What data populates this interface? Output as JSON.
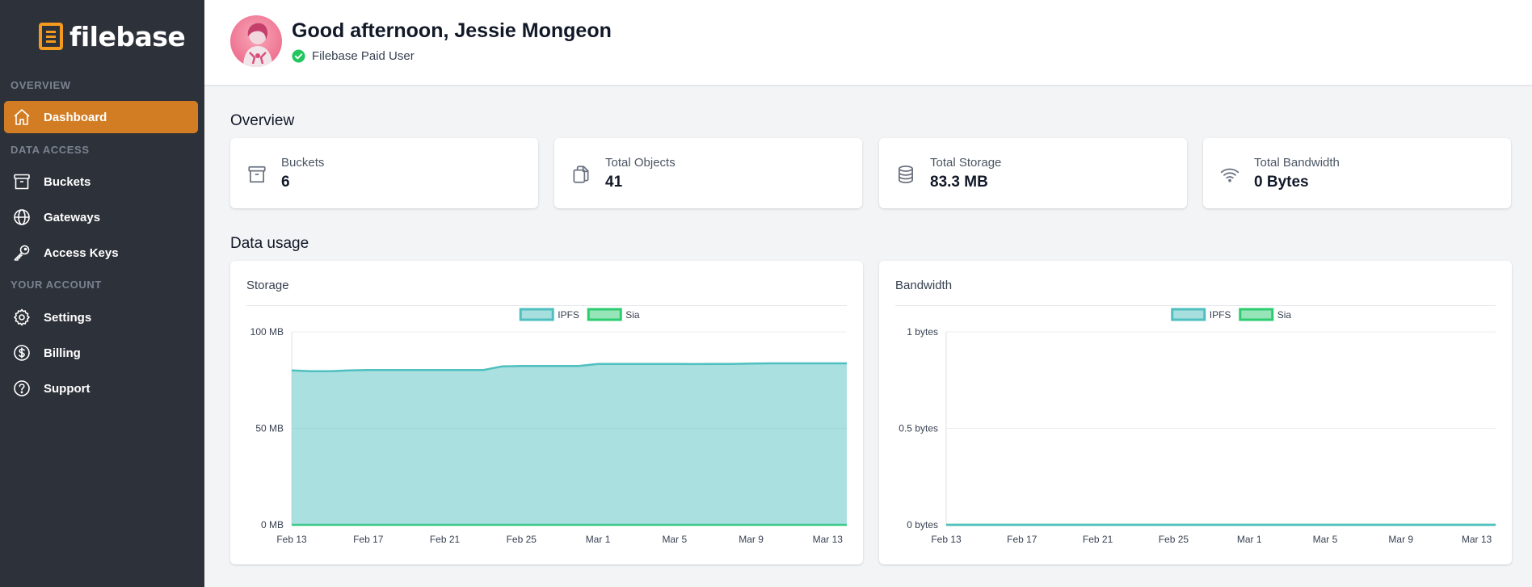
{
  "brand": {
    "name": "filebase",
    "accent": "#d27d23"
  },
  "sidebar": {
    "sections": [
      {
        "label": "OVERVIEW"
      },
      {
        "label": "DATA ACCESS"
      },
      {
        "label": "YOUR ACCOUNT"
      }
    ],
    "items": [
      {
        "label": "Dashboard",
        "icon": "home-icon",
        "active": true
      },
      {
        "label": "Buckets",
        "icon": "archive-icon"
      },
      {
        "label": "Gateways",
        "icon": "globe-icon"
      },
      {
        "label": "Access Keys",
        "icon": "key-icon"
      },
      {
        "label": "Settings",
        "icon": "gear-icon"
      },
      {
        "label": "Billing",
        "icon": "dollar-circle-icon"
      },
      {
        "label": "Support",
        "icon": "question-circle-icon"
      }
    ]
  },
  "header": {
    "greeting": "Good afternoon, Jessie Mongeon",
    "status": "Filebase Paid User"
  },
  "overview": {
    "title": "Overview",
    "stats": [
      {
        "label": "Buckets",
        "value": "6",
        "icon": "archive-icon"
      },
      {
        "label": "Total Objects",
        "value": "41",
        "icon": "copy-icon"
      },
      {
        "label": "Total Storage",
        "value": "83.3 MB",
        "icon": "database-icon"
      },
      {
        "label": "Total Bandwidth",
        "value": "0 Bytes",
        "icon": "wifi-icon"
      }
    ]
  },
  "data_usage": {
    "title": "Data usage"
  },
  "chart_data": [
    {
      "type": "area",
      "title": "Storage",
      "legend": [
        "IPFS",
        "Sia"
      ],
      "legend_position": "top-center",
      "grid": true,
      "colors": {
        "IPFS": "#4fbfbf",
        "Sia": "#2ecc71"
      },
      "y_ticks": [
        "100 MB",
        "50 MB",
        "0 MB"
      ],
      "ylim": [
        0,
        100
      ],
      "x_ticks": [
        "Feb 13",
        "Feb 17",
        "Feb 21",
        "Feb 25",
        "Mar 1",
        "Mar 5",
        "Mar 9",
        "Mar 13"
      ],
      "x": [
        "Feb 13",
        "Feb 14",
        "Feb 15",
        "Feb 16",
        "Feb 17",
        "Feb 18",
        "Feb 19",
        "Feb 20",
        "Feb 21",
        "Feb 22",
        "Feb 23",
        "Feb 24",
        "Feb 25",
        "Feb 26",
        "Feb 27",
        "Feb 28",
        "Mar 1",
        "Mar 2",
        "Mar 3",
        "Mar 4",
        "Mar 5",
        "Mar 6",
        "Mar 7",
        "Mar 8",
        "Mar 9",
        "Mar 10",
        "Mar 11",
        "Mar 12",
        "Mar 13",
        "Mar 14"
      ],
      "series": [
        {
          "name": "IPFS",
          "values": [
            80.0,
            79.6,
            79.6,
            80.0,
            80.2,
            80.2,
            80.2,
            80.2,
            80.2,
            80.2,
            80.2,
            82.1,
            82.3,
            82.3,
            82.3,
            82.3,
            83.4,
            83.4,
            83.4,
            83.4,
            83.4,
            83.3,
            83.4,
            83.4,
            83.6,
            83.7,
            83.7,
            83.7,
            83.7,
            83.7
          ]
        },
        {
          "name": "Sia",
          "values": [
            0,
            0,
            0,
            0,
            0,
            0,
            0,
            0,
            0,
            0,
            0,
            0,
            0,
            0,
            0,
            0,
            0,
            0,
            0,
            0,
            0,
            0,
            0,
            0,
            0,
            0,
            0,
            0,
            0,
            0
          ]
        }
      ]
    },
    {
      "type": "area",
      "title": "Bandwidth",
      "legend": [
        "IPFS",
        "Sia"
      ],
      "legend_position": "top-center",
      "grid": true,
      "colors": {
        "IPFS": "#4fbfbf",
        "Sia": "#2ecc71"
      },
      "y_ticks": [
        "1 bytes",
        "0.5 bytes",
        "0 bytes"
      ],
      "ylim": [
        0,
        1
      ],
      "x_ticks": [
        "Feb 13",
        "Feb 17",
        "Feb 21",
        "Feb 25",
        "Mar 1",
        "Mar 5",
        "Mar 9",
        "Mar 13"
      ],
      "x": [
        "Feb 13",
        "Feb 14",
        "Feb 15",
        "Feb 16",
        "Feb 17",
        "Feb 18",
        "Feb 19",
        "Feb 20",
        "Feb 21",
        "Feb 22",
        "Feb 23",
        "Feb 24",
        "Feb 25",
        "Feb 26",
        "Feb 27",
        "Feb 28",
        "Mar 1",
        "Mar 2",
        "Mar 3",
        "Mar 4",
        "Mar 5",
        "Mar 6",
        "Mar 7",
        "Mar 8",
        "Mar 9",
        "Mar 10",
        "Mar 11",
        "Mar 12",
        "Mar 13",
        "Mar 14"
      ],
      "series": [
        {
          "name": "IPFS",
          "values": [
            0,
            0,
            0,
            0,
            0,
            0,
            0,
            0,
            0,
            0,
            0,
            0,
            0,
            0,
            0,
            0,
            0,
            0,
            0,
            0,
            0,
            0,
            0,
            0,
            0,
            0,
            0,
            0,
            0,
            0
          ]
        },
        {
          "name": "Sia",
          "values": [
            0,
            0,
            0,
            0,
            0,
            0,
            0,
            0,
            0,
            0,
            0,
            0,
            0,
            0,
            0,
            0,
            0,
            0,
            0,
            0,
            0,
            0,
            0,
            0,
            0,
            0,
            0,
            0,
            0,
            0
          ]
        }
      ]
    }
  ]
}
